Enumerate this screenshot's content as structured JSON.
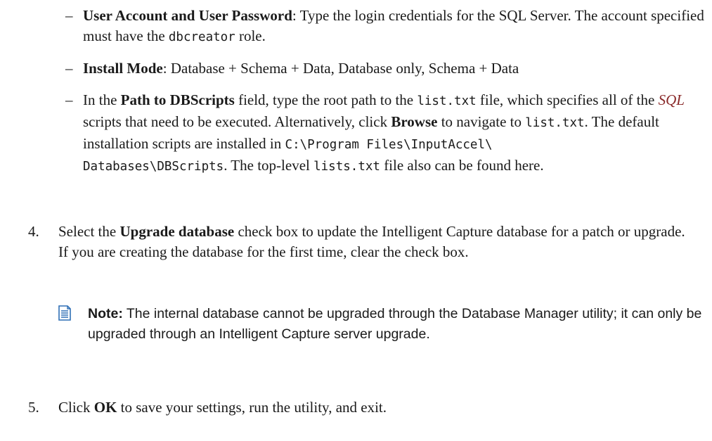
{
  "bullets": [
    {
      "dash": "–",
      "term": "User Account and User Password",
      "text_a": ": Type the login credentials for the SQL Server. The account specified must have the ",
      "code": "dbcreator",
      "text_b": " role."
    },
    {
      "dash": "–",
      "term": "Install Mode",
      "text_a": ": Database + Schema + Data, Database only, Schema + Data"
    },
    {
      "dash": "–",
      "p1": "In the ",
      "term": "Path to DBScripts",
      "p2": " field, type the root path to the ",
      "code1": "list.txt",
      "p3": " file, which specifies all of the ",
      "link": "SQL",
      "p4": " scripts that need to be executed. Alternatively, click ",
      "term2": "Browse",
      "p5": " to navigate to ",
      "code2": "list.txt",
      "p6": ". The default installation scripts are installed in ",
      "code3a": "C:\\Program Files\\InputAccel\\",
      "code3b": "Databases\\DBScripts",
      "p7": ". The top-level ",
      "code4": "lists.txt",
      "p8": " file also can be found here."
    }
  ],
  "steps": [
    {
      "number": "4.",
      "p1": "Select the ",
      "term": "Upgrade database",
      "p2": " check box to update the Intelligent Capture database for a patch or upgrade. If you are creating the database for the first time, clear the check box."
    },
    {
      "number": "5.",
      "p1": "Click ",
      "term": "OK",
      "p2": " to save your settings, run the utility, and exit."
    }
  ],
  "note": {
    "icon": "note-icon",
    "label": "Note:",
    "text": " The internal database cannot be upgraded through the Database Manager utility; it can only be upgraded through an Intelligent Capture server upgrade."
  },
  "colors": {
    "link": "#8a2a2a",
    "icon": "#2f6fb5"
  }
}
